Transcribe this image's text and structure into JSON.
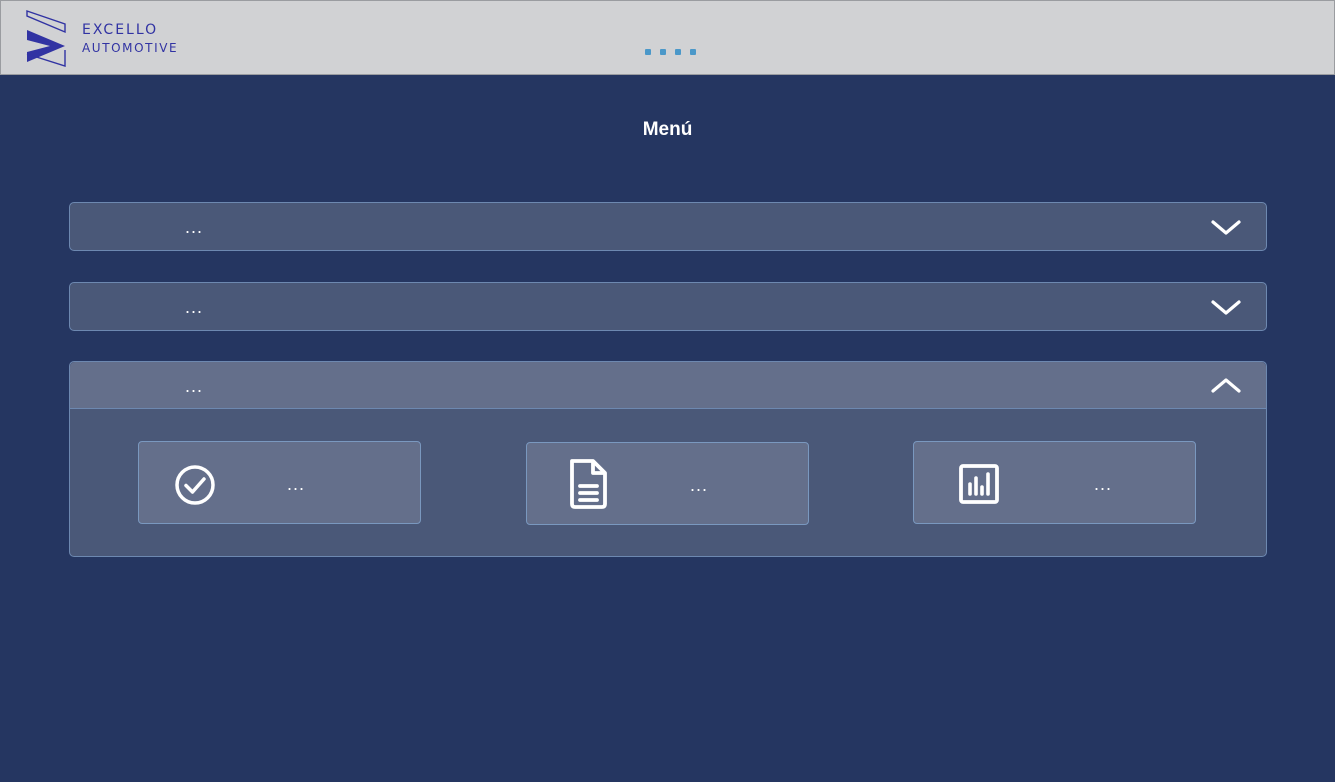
{
  "header": {
    "brand_line1": "EXCELLO",
    "brand_line2": "AUTOMOTIVE",
    "brand_color": "#3133a3",
    "indicator_color": "#4b98c9"
  },
  "page": {
    "title": "Menú"
  },
  "accordions": [
    {
      "label": "...",
      "expanded": false,
      "icon": "chevron-down-icon"
    },
    {
      "label": "...",
      "expanded": false,
      "icon": "chevron-down-icon"
    },
    {
      "label": "...",
      "expanded": true,
      "icon": "chevron-up-icon",
      "items": [
        {
          "label": "...",
          "icon": "check-circle-icon"
        },
        {
          "label": "...",
          "icon": "document-icon"
        },
        {
          "label": "...",
          "icon": "bar-chart-icon"
        }
      ]
    }
  ],
  "colors": {
    "background": "#253661",
    "topbar": "#d1d2d4",
    "panel": "#4a5878",
    "panel_active": "#646f8b",
    "panel_border": "#6d88b0"
  }
}
